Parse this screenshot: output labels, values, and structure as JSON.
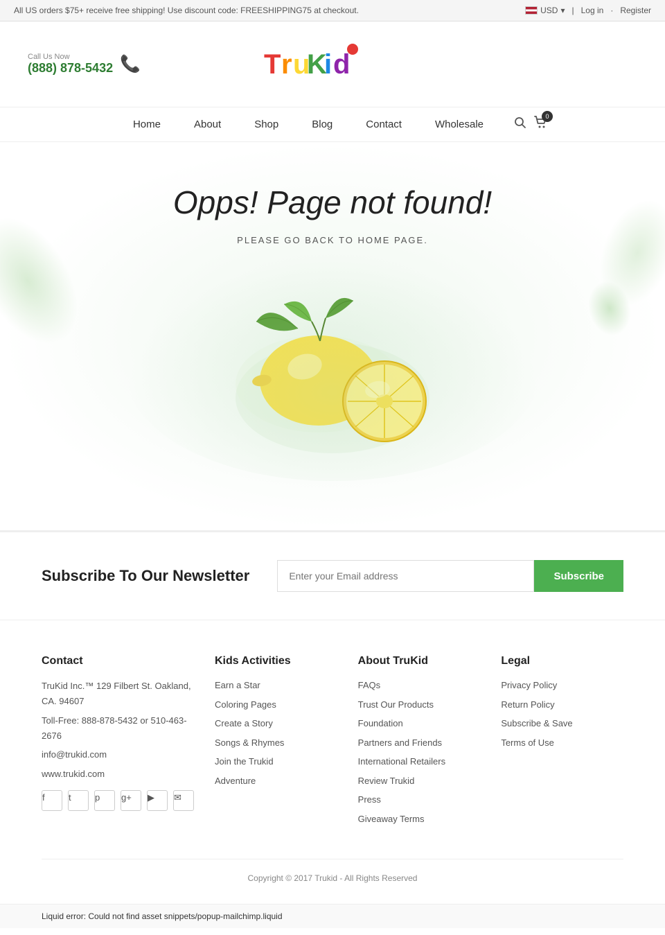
{
  "topbar": {
    "promo_text": "All US orders $75+ receive free shipping! Use discount code: FREESHIPPING75 at checkout.",
    "currency_label": "USD",
    "login_label": "Log in",
    "register_label": "Register"
  },
  "header": {
    "call_label": "Call Us Now",
    "phone": "(888) 878-5432",
    "logo": "TruKid"
  },
  "nav": {
    "items": [
      {
        "label": "Home",
        "href": "#"
      },
      {
        "label": "About",
        "href": "#"
      },
      {
        "label": "Shop",
        "href": "#"
      },
      {
        "label": "Blog",
        "href": "#"
      },
      {
        "label": "Contact",
        "href": "#"
      },
      {
        "label": "Wholesale",
        "href": "#"
      }
    ],
    "cart_count": "0"
  },
  "hero": {
    "title": "Opps! Page not found!",
    "subtitle_prefix": "PLEASE GO BACK TO",
    "subtitle_link": "HOME PAGE.",
    "subtitle_link_href": "#"
  },
  "newsletter": {
    "title": "Subscribe To Our Newsletter",
    "placeholder": "Enter your Email address",
    "button_label": "Subscribe"
  },
  "footer": {
    "columns": [
      {
        "title": "Contact",
        "address": "TruKid Inc.™ 129 Filbert St. Oakland, CA. 94607",
        "toll_free": "Toll-Free: 888-878-5432 or 510-463-2676",
        "email": "info@trukid.com",
        "website": "www.trukid.com",
        "social": [
          {
            "name": "facebook",
            "icon": "f"
          },
          {
            "name": "twitter",
            "icon": "t"
          },
          {
            "name": "pinterest",
            "icon": "p"
          },
          {
            "name": "googleplus",
            "icon": "g+"
          },
          {
            "name": "youtube",
            "icon": "▶"
          },
          {
            "name": "instagram",
            "icon": "✉"
          }
        ]
      },
      {
        "title": "Kids Activities",
        "links": [
          {
            "label": "Earn a Star",
            "href": "#"
          },
          {
            "label": "Coloring Pages",
            "href": "#"
          },
          {
            "label": "Create a Story",
            "href": "#"
          },
          {
            "label": "Songs & Rhymes",
            "href": "#"
          },
          {
            "label": "Join the Trukid",
            "href": "#"
          },
          {
            "label": "Adventure",
            "href": "#"
          }
        ]
      },
      {
        "title": "About TruKid",
        "links": [
          {
            "label": "FAQs",
            "href": "#"
          },
          {
            "label": "Trust Our Products",
            "href": "#"
          },
          {
            "label": "Foundation",
            "href": "#"
          },
          {
            "label": "Partners and Friends",
            "href": "#"
          },
          {
            "label": "International Retailers",
            "href": "#"
          },
          {
            "label": "Review Trukid",
            "href": "#"
          },
          {
            "label": "Press",
            "href": "#"
          },
          {
            "label": "Giveaway Terms",
            "href": "#"
          }
        ]
      },
      {
        "title": "Legal",
        "links": [
          {
            "label": "Privacy Policy",
            "href": "#"
          },
          {
            "label": "Return Policy",
            "href": "#"
          },
          {
            "label": "Subscribe & Save",
            "href": "#"
          },
          {
            "label": "Terms of Use",
            "href": "#"
          }
        ]
      }
    ],
    "copyright": "Copyright © 2017 Trukid - All Rights Reserved"
  },
  "liquid_error": "Liquid error: Could not find asset snippets/popup-mailchimp.liquid"
}
